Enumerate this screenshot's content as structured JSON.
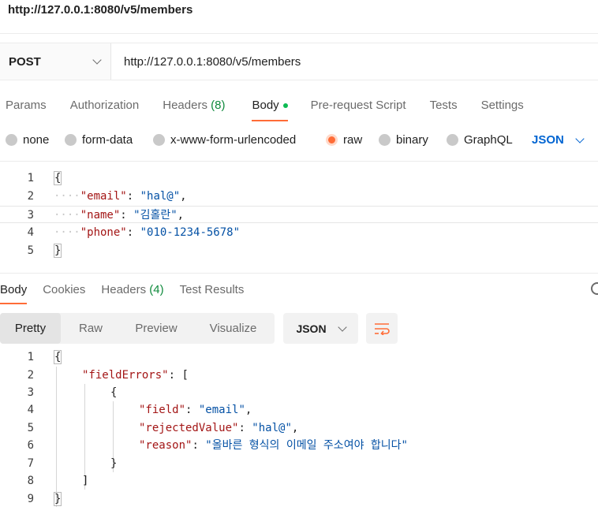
{
  "window": {
    "title": "http://127.0.0.1:8080/v5/members"
  },
  "request": {
    "method": "POST",
    "url": "http://127.0.0.1:8080/v5/members",
    "tabs": [
      {
        "label": "Params"
      },
      {
        "label": "Authorization"
      },
      {
        "label": "Headers",
        "count": "(8)"
      },
      {
        "label": "Body"
      },
      {
        "label": "Pre-request Script"
      },
      {
        "label": "Tests"
      },
      {
        "label": "Settings"
      }
    ],
    "body_types": [
      "none",
      "form-data",
      "x-www-form-urlencoded",
      "raw",
      "binary",
      "GraphQL"
    ],
    "selected_body_type": "raw",
    "body_format": "JSON",
    "line_numbers": [
      "1",
      "2",
      "3",
      "4",
      "5"
    ],
    "body_lines": {
      "open": "{",
      "k1": "\"email\"",
      "v1": "\"hal@\"",
      "k2": "\"name\"",
      "v2": "\"김홀란\"",
      "k3": "\"phone\"",
      "v3": "\"010-1234-5678\"",
      "close": "}"
    }
  },
  "response": {
    "tabs": [
      {
        "label": "Body"
      },
      {
        "label": "Cookies"
      },
      {
        "label": "Headers",
        "count": "(4)"
      },
      {
        "label": "Test Results"
      }
    ],
    "views": [
      "Pretty",
      "Raw",
      "Preview",
      "Visualize"
    ],
    "format": "JSON",
    "line_numbers": [
      "1",
      "2",
      "3",
      "4",
      "5",
      "6",
      "7",
      "8",
      "9"
    ],
    "body_lines": {
      "open": "{",
      "k_errors": "\"fieldErrors\"",
      "arr_open": "[",
      "obj_open": "{",
      "k_field": "\"field\"",
      "v_field": "\"email\"",
      "k_rejected": "\"rejectedValue\"",
      "v_rejected": "\"hal@\"",
      "k_reason": "\"reason\"",
      "v_reason": "\"올바른 형식의 이메일 주소여야 합니다\"",
      "obj_close": "}",
      "arr_close": "]",
      "close": "}"
    }
  },
  "colors": {
    "accent": "#ff6c37",
    "link": "#0265d2",
    "key": "#a31515",
    "string": "#0451a5",
    "count": "#0f8a3c"
  }
}
